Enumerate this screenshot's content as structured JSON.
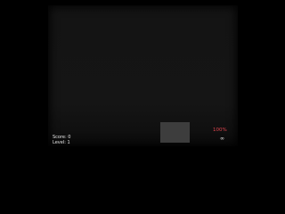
{
  "hud": {
    "score_label": "Score: 0",
    "level_label": "Level: 1",
    "health_text": "100%",
    "ammo_text": "∞"
  },
  "colors": {
    "background": "#000000",
    "playfield": "#141414",
    "player_block": "#3d3d3d",
    "health": "#e0454f",
    "hud_text": "#e6e6e6"
  }
}
